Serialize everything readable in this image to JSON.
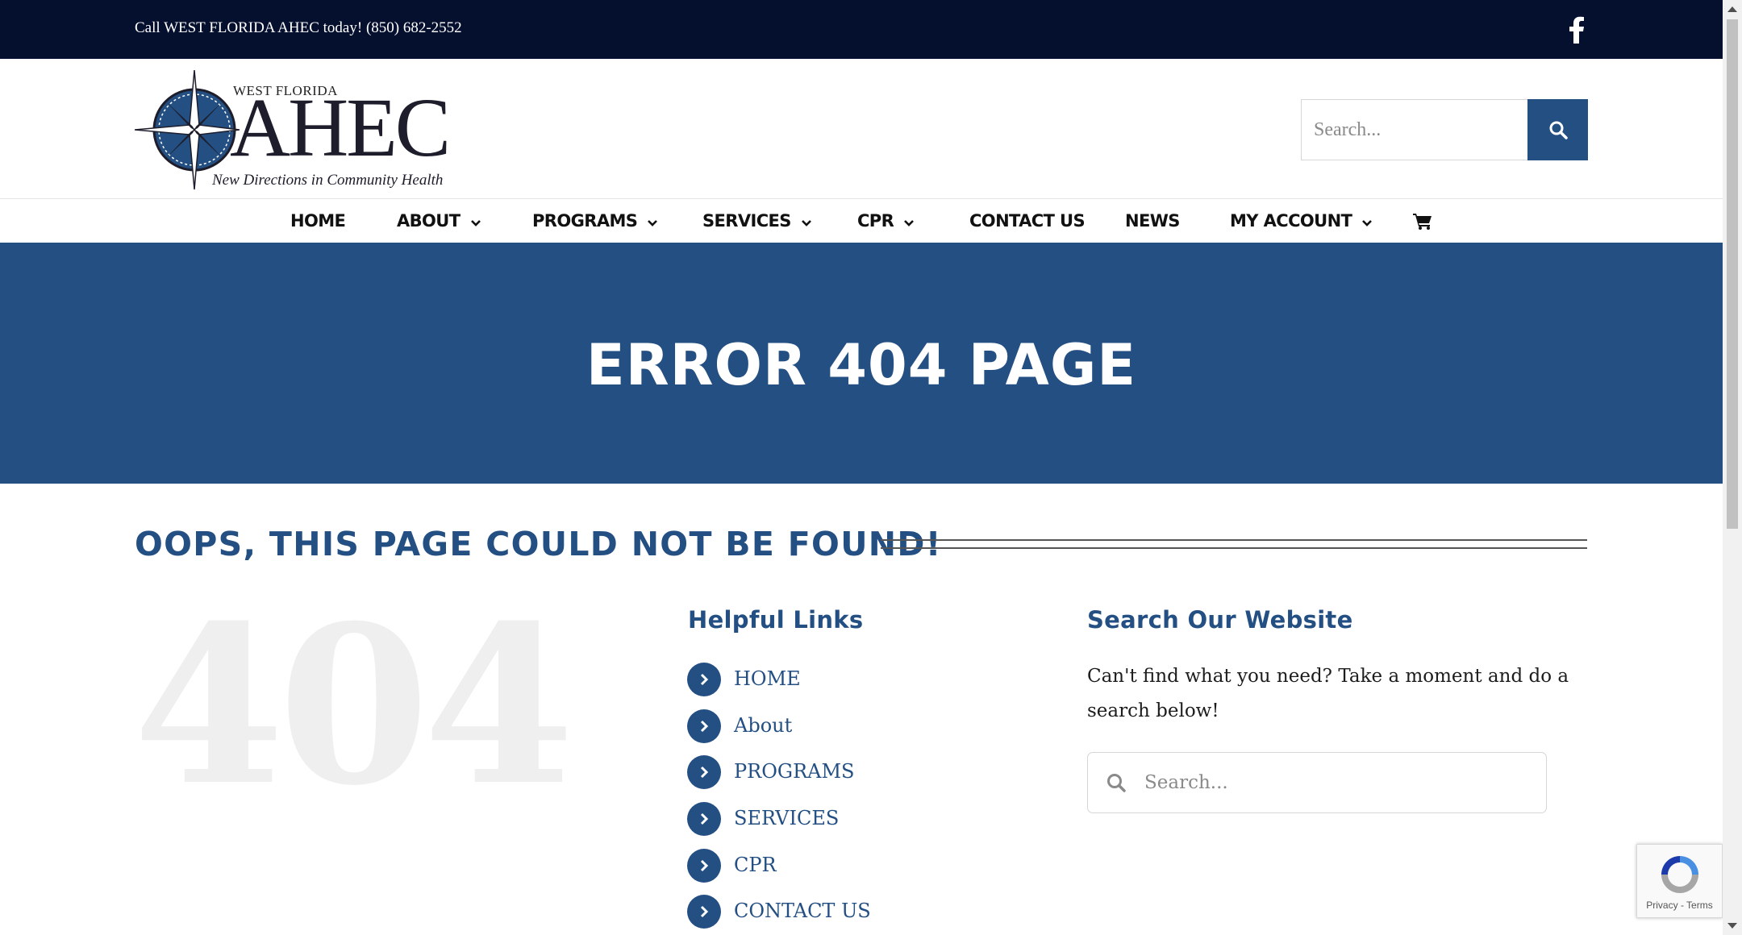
{
  "topbar": {
    "phone_text": "Call WEST FLORIDA AHEC today! (850) 682-2552",
    "social_icon": "facebook-icon"
  },
  "logo": {
    "line1": "WEST FLORIDA",
    "line2": "AHEC",
    "tagline": "New Directions in Community Health"
  },
  "header_search": {
    "placeholder": "Search...",
    "button_icon": "search-icon"
  },
  "nav": {
    "items": [
      {
        "label": "HOME",
        "has_dropdown": false
      },
      {
        "label": "ABOUT",
        "has_dropdown": true
      },
      {
        "label": "PROGRAMS",
        "has_dropdown": true
      },
      {
        "label": "SERVICES",
        "has_dropdown": true
      },
      {
        "label": "CPR",
        "has_dropdown": true
      },
      {
        "label": "CONTACT US",
        "has_dropdown": false
      },
      {
        "label": "NEWS",
        "has_dropdown": false
      },
      {
        "label": "MY ACCOUNT",
        "has_dropdown": true
      }
    ],
    "cart_icon": "cart-icon"
  },
  "banner": {
    "title": "ERROR 404 PAGE"
  },
  "main": {
    "oops_heading": "OOPS, THIS PAGE COULD NOT BE FOUND!",
    "big_code": "404",
    "helpful_links": {
      "title": "Helpful Links",
      "items": [
        "HOME",
        "About",
        "PROGRAMS",
        "SERVICES",
        "CPR",
        "CONTACT US"
      ]
    },
    "search_section": {
      "title": "Search Our Website",
      "description": "Can't find what you need? Take a moment and do a search below!",
      "placeholder": "Search..."
    }
  },
  "recaptcha": {
    "terms": "Privacy - Terms"
  },
  "colors": {
    "topbar_bg": "#050f2e",
    "brand_blue": "#234f83",
    "text_dark": "#111111"
  }
}
